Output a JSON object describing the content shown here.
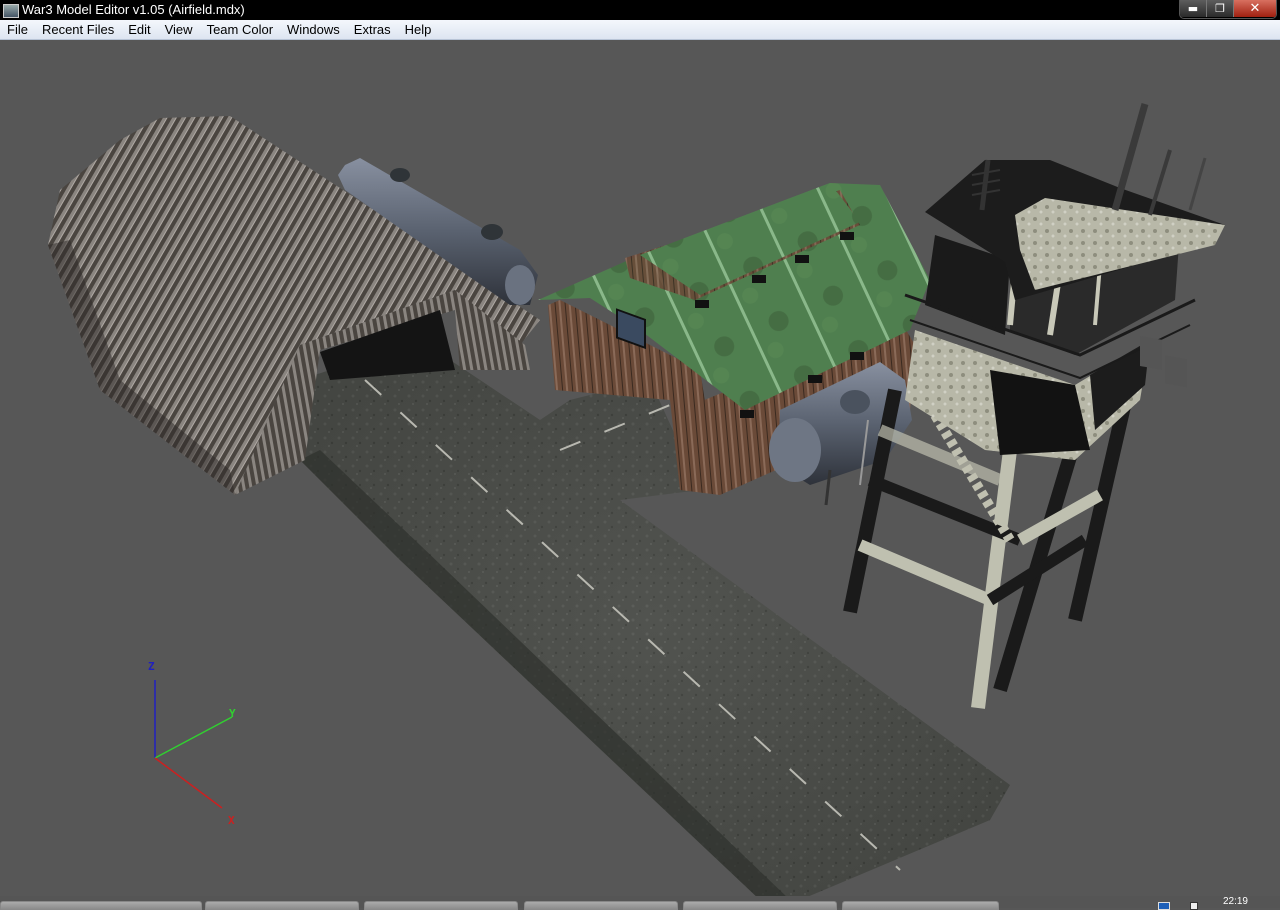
{
  "window": {
    "title": "War3 Model Editor v1.05 (Airfield.mdx)",
    "app_icon": "app-icon",
    "controls": {
      "minimize_icon": "minimize-icon",
      "maximize_icon": "restore-icon",
      "close_icon": "close-icon",
      "minimize_glyph": "▬",
      "restore_glyph": "❐",
      "close_glyph": "✕"
    }
  },
  "menubar": {
    "items": [
      {
        "label": "File"
      },
      {
        "label": "Recent Files"
      },
      {
        "label": "Edit"
      },
      {
        "label": "View"
      },
      {
        "label": "Team Color"
      },
      {
        "label": "Windows"
      },
      {
        "label": "Extras"
      },
      {
        "label": "Help"
      }
    ]
  },
  "viewport": {
    "background": "#575757",
    "model_file": "Airfield.mdx",
    "objects": [
      "quonset-hangar",
      "fuel-tank-on-hangar",
      "wooden-barn-green-roof",
      "fuel-tank-by-barn",
      "control-tower",
      "runway"
    ],
    "axis_gizmo": {
      "x_label": "X",
      "y_label": "Y",
      "z_label": "Z",
      "x_color": "#cc2020",
      "y_color": "#30d030",
      "z_color": "#2020c0"
    }
  },
  "taskbar": {
    "clock": "22:19"
  }
}
